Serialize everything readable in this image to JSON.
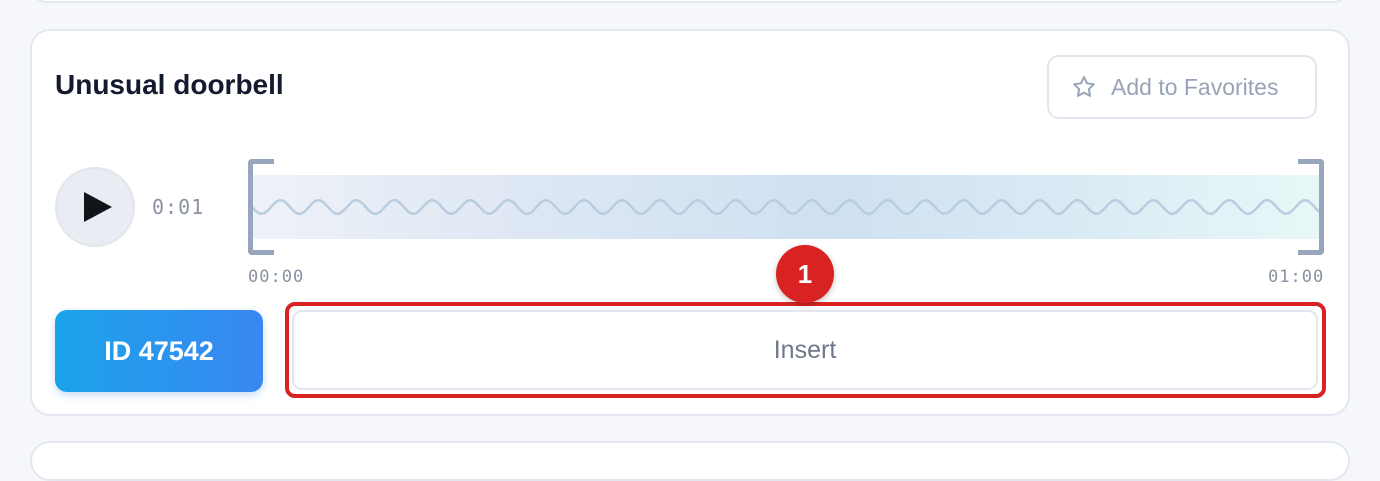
{
  "sound": {
    "title": "Unusual doorbell",
    "favorite_label": "Add to Favorites",
    "current_time": "0:01",
    "timeline_start": "00:00",
    "timeline_end": "01:00",
    "id_label": "ID 47542",
    "insert_label": "Insert"
  },
  "annotation": {
    "badge_number": "1",
    "color": "#d92323"
  },
  "icons": {
    "favorite": "star-outline-icon",
    "play": "play-icon"
  },
  "colors": {
    "accent_gradient_start": "#1aa4ea",
    "accent_gradient_end": "#3a86f2",
    "title": "#141a2e",
    "muted": "#97a3b6"
  }
}
